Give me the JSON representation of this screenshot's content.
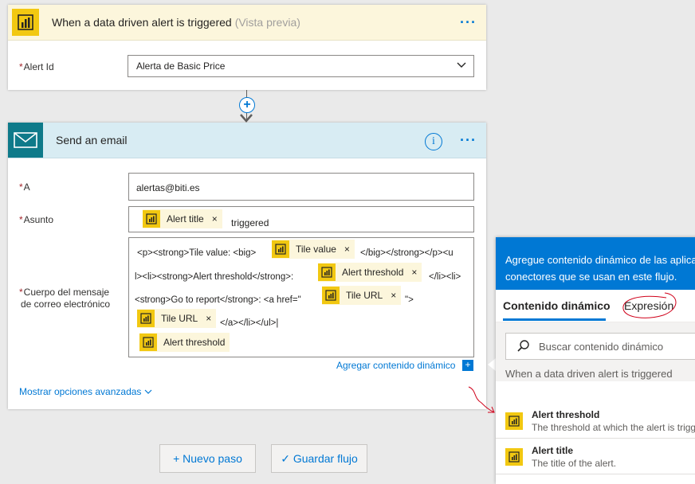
{
  "trigger": {
    "title": "When a data driven alert is triggered",
    "subtitle": "(Vista previa)",
    "more": "···",
    "alert_id_label": "Alert Id",
    "alert_id_value": "Alerta de Basic Price"
  },
  "email": {
    "title": "Send an email",
    "more": "···",
    "info": "i",
    "to_label": "A",
    "to_value": "alertas@biti.es",
    "subject_label": "Asunto",
    "subject_token": "Alert title",
    "subject_text": "triggered",
    "body_label_1": "Cuerpo del mensaje",
    "body_label_2": "de correo electrónico",
    "body": {
      "l1a": "<p><strong>Tile value: <big>",
      "t1": "Tile value",
      "l1b": "</big></strong></p><u",
      "l2a": "l><li><strong>Alert threshold</strong>:",
      "t2": "Alert threshold",
      "l2b": "</li><li>",
      "l3a": "<strong>Go to report</strong>: <a href=\"",
      "t3": "Tile URL",
      "l3b": "\">",
      "t4": "Tile URL",
      "l4": "</a></li></ul>|",
      "t5": "Alert threshold"
    },
    "add_dynamic": "Agregar contenido dinámico",
    "advanced": "Mostrar opciones avanzadas"
  },
  "buttons": {
    "new_step": "+ Nuevo paso",
    "save": "✓ Guardar flujo"
  },
  "panel": {
    "header_1": "Agregue contenido dinámico de las aplica",
    "header_2": "conectores que se usan en este flujo.",
    "tab_dynamic": "Contenido dinámico",
    "tab_expression": "Expresión",
    "search_placeholder": "Buscar contenido dinámico",
    "section": "When a data driven alert is triggered",
    "items": [
      {
        "title": "Alert threshold",
        "desc": "The threshold at which the alert is trigg"
      },
      {
        "title": "Alert title",
        "desc": "The title of the alert."
      }
    ]
  },
  "colors": {
    "accent": "#0078d4",
    "powerbi": "#f2c811",
    "annotation": "#d0021b"
  }
}
